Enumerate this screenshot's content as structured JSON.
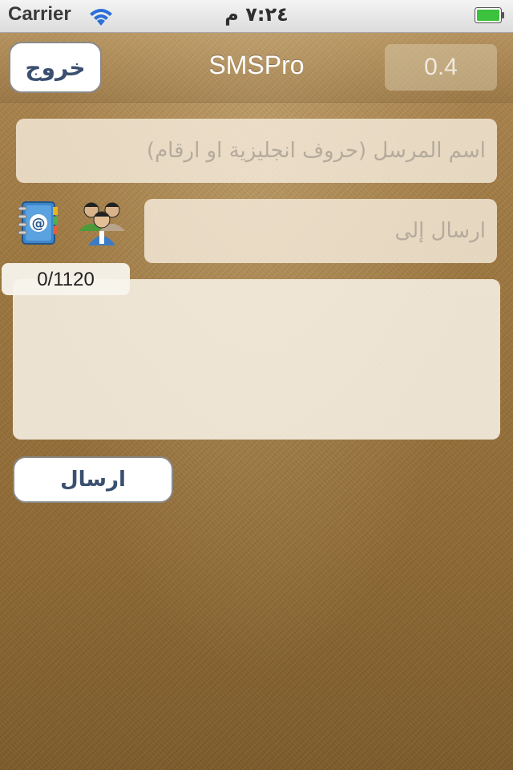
{
  "status_bar": {
    "carrier": "Carrier",
    "time": "٧:٢٤ م"
  },
  "nav": {
    "exit_label": "خروج",
    "title": "SMSPro",
    "version_label": "0.4"
  },
  "form": {
    "sender_placeholder": "اسم المرسل (حروف انجليزية او ارقام)",
    "sender_value": "",
    "to_placeholder": "ارسال إلى",
    "to_value": "",
    "message_value": "",
    "char_counter": "0/1120",
    "send_label": "ارسال"
  },
  "icons": {
    "address_book": "address-book-icon",
    "contacts": "contacts-group-icon",
    "wifi": "wifi-icon",
    "battery": "battery-icon"
  },
  "colors": {
    "button_text": "#3b4f70",
    "battery_fill": "#3cc23c",
    "background": "#a07a42"
  }
}
